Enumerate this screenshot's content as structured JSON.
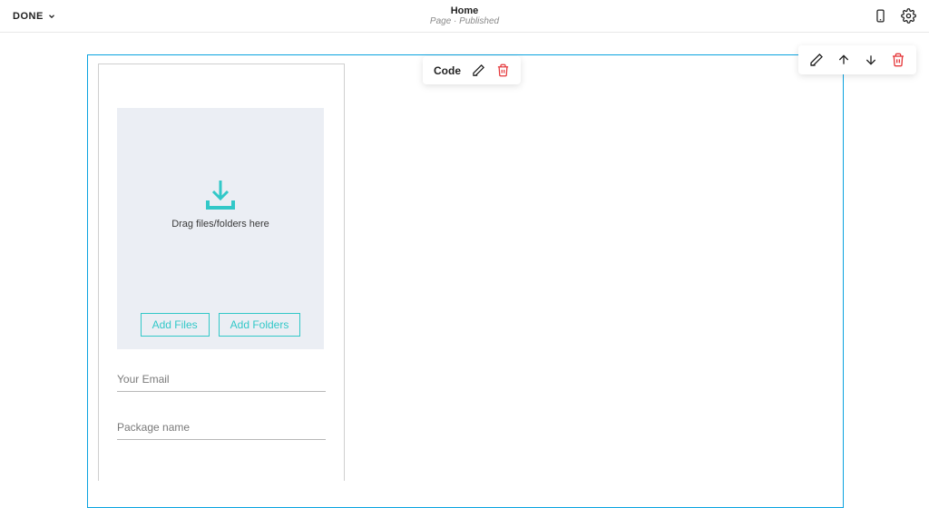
{
  "header": {
    "done_label": "DONE",
    "title": "Home",
    "subtitle": "Page · Published",
    "icons": {
      "device": "phone-icon",
      "settings": "gear-icon"
    }
  },
  "code_toolbar": {
    "label": "Code"
  },
  "dropzone": {
    "prompt": "Drag files/folders here",
    "add_files_label": "Add Files",
    "add_folders_label": "Add Folders"
  },
  "form": {
    "email_placeholder": "Your Email",
    "package_placeholder": "Package name"
  },
  "colors": {
    "selection": "#0aa3e0",
    "teal": "#32c8c8",
    "danger": "#e5383b"
  }
}
